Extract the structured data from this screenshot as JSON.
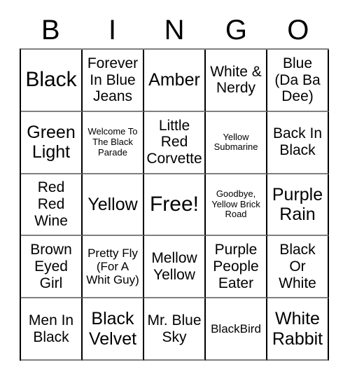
{
  "card": {
    "header_letters": [
      "B",
      "I",
      "N",
      "G",
      "O"
    ],
    "rows": [
      [
        {
          "text": "Black",
          "size": "xl"
        },
        {
          "text": "Forever In Blue Jeans",
          "size": "md"
        },
        {
          "text": "Amber",
          "size": "lg"
        },
        {
          "text": "White & Nerdy",
          "size": "md"
        },
        {
          "text": "Blue (Da Ba Dee)",
          "size": "md"
        }
      ],
      [
        {
          "text": "Green Light",
          "size": "lg"
        },
        {
          "text": "Welcome To The Black Parade",
          "size": "xs"
        },
        {
          "text": "Little Red Corvette",
          "size": "md"
        },
        {
          "text": "Yellow Submarine",
          "size": "xs"
        },
        {
          "text": "Back In Black",
          "size": "md"
        }
      ],
      [
        {
          "text": "Red Red Wine",
          "size": "md"
        },
        {
          "text": "Yellow",
          "size": "lg"
        },
        {
          "text": "Free!",
          "size": "xl"
        },
        {
          "text": "Goodbye, Yellow Brick Road",
          "size": "xs"
        },
        {
          "text": "Purple Rain",
          "size": "lg"
        }
      ],
      [
        {
          "text": "Brown Eyed Girl",
          "size": "md"
        },
        {
          "text": "Pretty Fly (For A Whit Guy)",
          "size": "sm"
        },
        {
          "text": "Mellow Yellow",
          "size": "md"
        },
        {
          "text": "Purple People Eater",
          "size": "md"
        },
        {
          "text": "Black Or White",
          "size": "md"
        }
      ],
      [
        {
          "text": "Men In Black",
          "size": "md"
        },
        {
          "text": "Black Velvet",
          "size": "lg"
        },
        {
          "text": "Mr. Blue Sky",
          "size": "md"
        },
        {
          "text": "BlackBird",
          "size": "sm"
        },
        {
          "text": "White Rabbit",
          "size": "lg"
        }
      ]
    ]
  },
  "colors": {
    "background": "#ffffff",
    "text": "#000000",
    "grid_line": "#000000",
    "grid_line_light": "#808080"
  }
}
